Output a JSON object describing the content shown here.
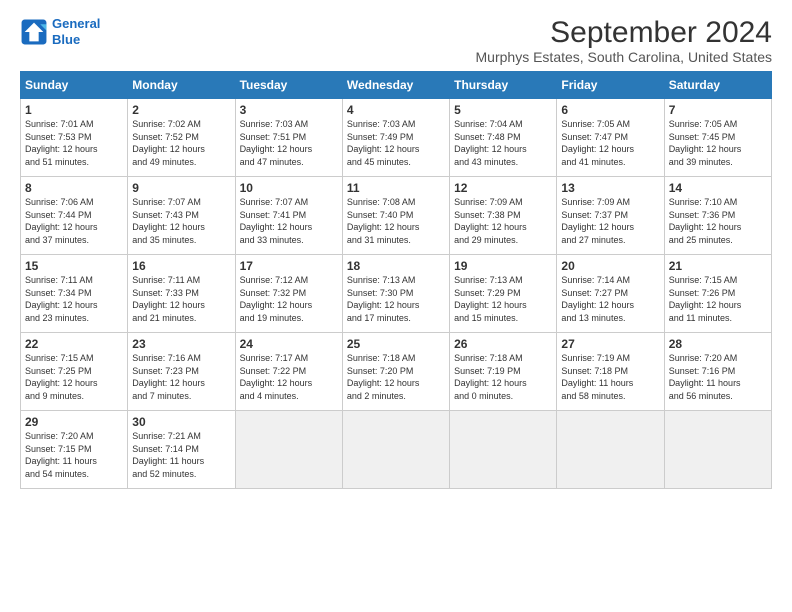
{
  "header": {
    "logo_line1": "General",
    "logo_line2": "Blue",
    "title": "September 2024",
    "subtitle": "Murphys Estates, South Carolina, United States"
  },
  "columns": [
    "Sunday",
    "Monday",
    "Tuesday",
    "Wednesday",
    "Thursday",
    "Friday",
    "Saturday"
  ],
  "weeks": [
    [
      {
        "day": "1",
        "info": "Sunrise: 7:01 AM\nSunset: 7:53 PM\nDaylight: 12 hours\nand 51 minutes."
      },
      {
        "day": "2",
        "info": "Sunrise: 7:02 AM\nSunset: 7:52 PM\nDaylight: 12 hours\nand 49 minutes."
      },
      {
        "day": "3",
        "info": "Sunrise: 7:03 AM\nSunset: 7:51 PM\nDaylight: 12 hours\nand 47 minutes."
      },
      {
        "day": "4",
        "info": "Sunrise: 7:03 AM\nSunset: 7:49 PM\nDaylight: 12 hours\nand 45 minutes."
      },
      {
        "day": "5",
        "info": "Sunrise: 7:04 AM\nSunset: 7:48 PM\nDaylight: 12 hours\nand 43 minutes."
      },
      {
        "day": "6",
        "info": "Sunrise: 7:05 AM\nSunset: 7:47 PM\nDaylight: 12 hours\nand 41 minutes."
      },
      {
        "day": "7",
        "info": "Sunrise: 7:05 AM\nSunset: 7:45 PM\nDaylight: 12 hours\nand 39 minutes."
      }
    ],
    [
      {
        "day": "8",
        "info": "Sunrise: 7:06 AM\nSunset: 7:44 PM\nDaylight: 12 hours\nand 37 minutes."
      },
      {
        "day": "9",
        "info": "Sunrise: 7:07 AM\nSunset: 7:43 PM\nDaylight: 12 hours\nand 35 minutes."
      },
      {
        "day": "10",
        "info": "Sunrise: 7:07 AM\nSunset: 7:41 PM\nDaylight: 12 hours\nand 33 minutes."
      },
      {
        "day": "11",
        "info": "Sunrise: 7:08 AM\nSunset: 7:40 PM\nDaylight: 12 hours\nand 31 minutes."
      },
      {
        "day": "12",
        "info": "Sunrise: 7:09 AM\nSunset: 7:38 PM\nDaylight: 12 hours\nand 29 minutes."
      },
      {
        "day": "13",
        "info": "Sunrise: 7:09 AM\nSunset: 7:37 PM\nDaylight: 12 hours\nand 27 minutes."
      },
      {
        "day": "14",
        "info": "Sunrise: 7:10 AM\nSunset: 7:36 PM\nDaylight: 12 hours\nand 25 minutes."
      }
    ],
    [
      {
        "day": "15",
        "info": "Sunrise: 7:11 AM\nSunset: 7:34 PM\nDaylight: 12 hours\nand 23 minutes."
      },
      {
        "day": "16",
        "info": "Sunrise: 7:11 AM\nSunset: 7:33 PM\nDaylight: 12 hours\nand 21 minutes."
      },
      {
        "day": "17",
        "info": "Sunrise: 7:12 AM\nSunset: 7:32 PM\nDaylight: 12 hours\nand 19 minutes."
      },
      {
        "day": "18",
        "info": "Sunrise: 7:13 AM\nSunset: 7:30 PM\nDaylight: 12 hours\nand 17 minutes."
      },
      {
        "day": "19",
        "info": "Sunrise: 7:13 AM\nSunset: 7:29 PM\nDaylight: 12 hours\nand 15 minutes."
      },
      {
        "day": "20",
        "info": "Sunrise: 7:14 AM\nSunset: 7:27 PM\nDaylight: 12 hours\nand 13 minutes."
      },
      {
        "day": "21",
        "info": "Sunrise: 7:15 AM\nSunset: 7:26 PM\nDaylight: 12 hours\nand 11 minutes."
      }
    ],
    [
      {
        "day": "22",
        "info": "Sunrise: 7:15 AM\nSunset: 7:25 PM\nDaylight: 12 hours\nand 9 minutes."
      },
      {
        "day": "23",
        "info": "Sunrise: 7:16 AM\nSunset: 7:23 PM\nDaylight: 12 hours\nand 7 minutes."
      },
      {
        "day": "24",
        "info": "Sunrise: 7:17 AM\nSunset: 7:22 PM\nDaylight: 12 hours\nand 4 minutes."
      },
      {
        "day": "25",
        "info": "Sunrise: 7:18 AM\nSunset: 7:20 PM\nDaylight: 12 hours\nand 2 minutes."
      },
      {
        "day": "26",
        "info": "Sunrise: 7:18 AM\nSunset: 7:19 PM\nDaylight: 12 hours\nand 0 minutes."
      },
      {
        "day": "27",
        "info": "Sunrise: 7:19 AM\nSunset: 7:18 PM\nDaylight: 11 hours\nand 58 minutes."
      },
      {
        "day": "28",
        "info": "Sunrise: 7:20 AM\nSunset: 7:16 PM\nDaylight: 11 hours\nand 56 minutes."
      }
    ],
    [
      {
        "day": "29",
        "info": "Sunrise: 7:20 AM\nSunset: 7:15 PM\nDaylight: 11 hours\nand 54 minutes."
      },
      {
        "day": "30",
        "info": "Sunrise: 7:21 AM\nSunset: 7:14 PM\nDaylight: 11 hours\nand 52 minutes."
      },
      null,
      null,
      null,
      null,
      null
    ]
  ]
}
